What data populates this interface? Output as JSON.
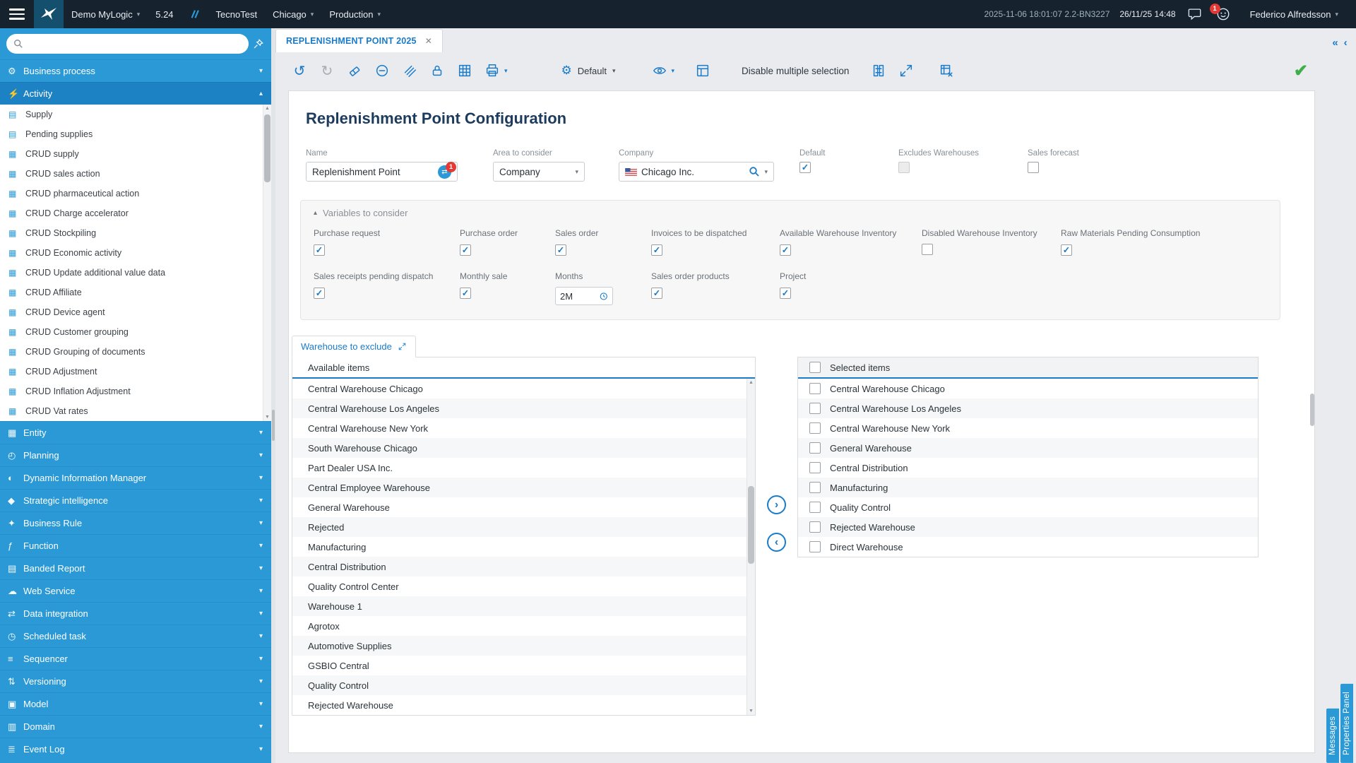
{
  "topbar": {
    "app_name": "Demo MyLogic",
    "version": "5.24",
    "company": "TecnoTest",
    "site": "Chicago",
    "environment": "Production",
    "build": "2025-11-06 18:01:07 2.2-BN3227",
    "datetime": "26/11/25 14:48",
    "notifications": "1",
    "user": "Federico Alfredsson"
  },
  "sidebar": {
    "items_top": [
      {
        "label": "Business process",
        "icon": "⚙"
      }
    ],
    "activity": {
      "label": "Activity",
      "icon": "⚡"
    },
    "activity_children": [
      {
        "label": "Supply",
        "icon": "▤"
      },
      {
        "label": "Pending supplies",
        "icon": "▤"
      },
      {
        "label": "CRUD supply",
        "icon": "▦"
      },
      {
        "label": "CRUD sales action",
        "icon": "▦"
      },
      {
        "label": "CRUD pharmaceutical action",
        "icon": "▦"
      },
      {
        "label": "CRUD Charge accelerator",
        "icon": "▦"
      },
      {
        "label": "CRUD Stockpiling",
        "icon": "▦"
      },
      {
        "label": "CRUD Economic activity",
        "icon": "▦"
      },
      {
        "label": "CRUD Update additional value data",
        "icon": "▦"
      },
      {
        "label": "CRUD Affiliate",
        "icon": "▦"
      },
      {
        "label": "CRUD Device agent",
        "icon": "▦"
      },
      {
        "label": "CRUD Customer grouping",
        "icon": "▦"
      },
      {
        "label": "CRUD Grouping of documents",
        "icon": "▦"
      },
      {
        "label": "CRUD Adjustment",
        "icon": "▦"
      },
      {
        "label": "CRUD Inflation Adjustment",
        "icon": "▦"
      },
      {
        "label": "CRUD Vat rates",
        "icon": "▦"
      }
    ],
    "items_bottom": [
      {
        "label": "Entity",
        "icon": "▦"
      },
      {
        "label": "Planning",
        "icon": "◴"
      },
      {
        "label": "Dynamic Information Manager",
        "icon": "◐"
      },
      {
        "label": "Strategic intelligence",
        "icon": "◆"
      },
      {
        "label": "Business Rule",
        "icon": "✦"
      },
      {
        "label": "Function",
        "icon": "ƒ"
      },
      {
        "label": "Banded Report",
        "icon": "▤"
      },
      {
        "label": "Web Service",
        "icon": "☁"
      },
      {
        "label": "Data integration",
        "icon": "⇄"
      },
      {
        "label": "Scheduled task",
        "icon": "◷"
      },
      {
        "label": "Sequencer",
        "icon": "≡"
      },
      {
        "label": "Versioning",
        "icon": "⇅"
      },
      {
        "label": "Model",
        "icon": "▣"
      },
      {
        "label": "Domain",
        "icon": "▥"
      },
      {
        "label": "Event Log",
        "icon": "≣"
      }
    ]
  },
  "tabs": {
    "main_tab": "REPLENISHMENT POINT 2025"
  },
  "toolbar": {
    "profile_label": "Default",
    "disable_multi_label": "Disable multiple selection"
  },
  "page": {
    "title": "Replenishment Point Configuration"
  },
  "form": {
    "name": {
      "label": "Name",
      "value": "Replenishment Point",
      "badge": "1"
    },
    "area": {
      "label": "Area to consider",
      "value": "Company"
    },
    "company": {
      "label": "Company",
      "value": "Chicago Inc."
    },
    "default": {
      "label": "Default",
      "checked": true
    },
    "excludes": {
      "label": "Excludes Warehouses",
      "checked": false
    },
    "sales_forecast": {
      "label": "Sales forecast",
      "checked": false
    }
  },
  "variables": {
    "title": "Variables to consider",
    "purchase_request": {
      "label": "Purchase request",
      "checked": true
    },
    "purchase_order": {
      "label": "Purchase order",
      "checked": true
    },
    "sales_order": {
      "label": "Sales order",
      "checked": true
    },
    "invoices": {
      "label": "Invoices to be dispatched",
      "checked": true
    },
    "available_wh": {
      "label": "Available Warehouse Inventory",
      "checked": true
    },
    "disabled_wh": {
      "label": "Disabled Warehouse Inventory",
      "checked": false
    },
    "raw_materials": {
      "label": "Raw Materials Pending Consumption",
      "checked": true
    },
    "sales_receipts": {
      "label": "Sales receipts pending dispatch",
      "checked": true
    },
    "monthly_sale": {
      "label": "Monthly sale",
      "checked": true
    },
    "months": {
      "label": "Months",
      "value": "2M"
    },
    "sales_order_products": {
      "label": "Sales order products",
      "checked": true
    },
    "project": {
      "label": "Project",
      "checked": true
    }
  },
  "warehouse_section": {
    "tab_label": "Warehouse to exclude",
    "available_header": "Available items",
    "selected_header": "Selected items",
    "available_items": [
      "Central Warehouse Chicago",
      "Central Warehouse Los Angeles",
      "Central Warehouse New York",
      "South Warehouse Chicago",
      "Part Dealer USA Inc.",
      "Central Employee Warehouse",
      "General Warehouse",
      "Rejected",
      "Manufacturing",
      "Central Distribution",
      "Quality Control Center",
      "Warehouse 1",
      "Agrotox",
      "Automotive Supplies",
      "GSBIO Central",
      "Quality Control",
      "Rejected Warehouse"
    ],
    "selected_items": [
      "Central Warehouse Chicago",
      "Central Warehouse Los Angeles",
      "Central Warehouse New York",
      "General Warehouse",
      "Central Distribution",
      "Manufacturing",
      "Quality Control",
      "Rejected Warehouse",
      "Direct Warehouse"
    ]
  },
  "right_rail": {
    "messages_tab": "Messages",
    "properties_tab": "Properties Panel"
  }
}
